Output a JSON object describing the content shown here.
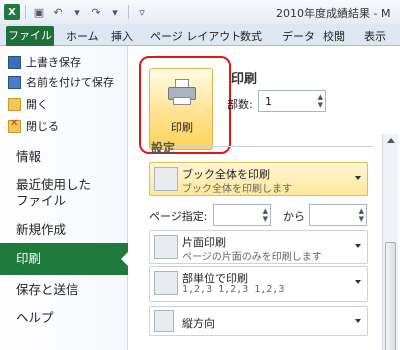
{
  "window": {
    "title": "2010年度成績結果 - M"
  },
  "ribbon": {
    "tabs": [
      "ファイル",
      "ホーム",
      "挿入",
      "ページ レイアウト",
      "数式",
      "データ",
      "校閲",
      "表示"
    ]
  },
  "backstage": {
    "commands": [
      "上書き保存",
      "名前を付けて保存",
      "開く",
      "閉じる"
    ],
    "nav": {
      "info": "情報",
      "recent_line1": "最近使用した",
      "recent_line2": "ファイル",
      "new": "新規作成",
      "print": "印刷",
      "share": "保存と送信",
      "help": "ヘルプ"
    }
  },
  "print": {
    "button_label": "印刷",
    "section_title": "印刷",
    "copies_label": "部数:",
    "copies_value": "1",
    "settings_label": "設定",
    "what_title": "ブック全体を印刷",
    "what_desc": "ブック全体を印刷します",
    "pages_label": "ページ指定:",
    "pages_to": "から",
    "sides_title": "片面印刷",
    "sides_desc": "ページの片面のみを印刷します",
    "collate_title": "部単位で印刷",
    "collate_desc": "1,2,3   1,2,3   1,2,3",
    "orientation_title": "縦方向"
  },
  "colors": {
    "accent": "#1e7a3d",
    "highlight_border": "#e01818",
    "selected_option": "#ffe79a"
  }
}
